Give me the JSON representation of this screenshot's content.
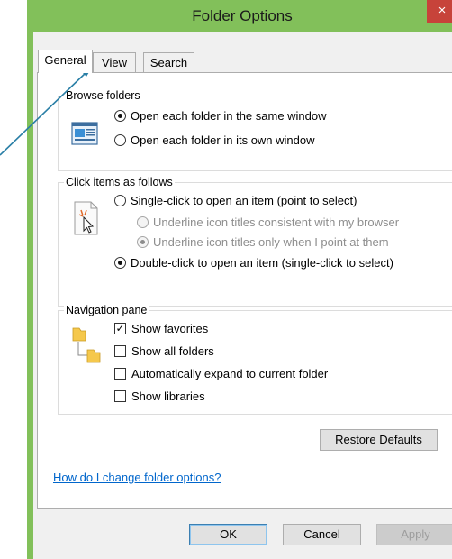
{
  "window": {
    "title": "Folder Options",
    "close_glyph": "×"
  },
  "tabs": [
    {
      "label": "General",
      "active": true
    },
    {
      "label": "View",
      "active": false
    },
    {
      "label": "Search",
      "active": false
    }
  ],
  "browse_folders": {
    "title": "Browse folders",
    "icon": "browse-window-icon",
    "options": [
      {
        "label": "Open each folder in the same window",
        "checked": true
      },
      {
        "label": "Open each folder in its own window",
        "checked": false
      }
    ]
  },
  "click_items": {
    "title": "Click items as follows",
    "icon": "pointer-click-icon",
    "options": [
      {
        "label": "Single-click to open an item (point to select)",
        "checked": false
      },
      {
        "label": "Underline icon titles consistent with my browser",
        "checked": false,
        "disabled": true
      },
      {
        "label": "Underline icon titles only when I point at them",
        "checked": true,
        "disabled": true
      },
      {
        "label": "Double-click to open an item (single-click to select)",
        "checked": true
      }
    ]
  },
  "navigation_pane": {
    "title": "Navigation pane",
    "icon": "folder-tree-icon",
    "options": [
      {
        "label": "Show favorites",
        "checked": true
      },
      {
        "label": "Show all folders",
        "checked": false
      },
      {
        "label": "Automatically expand to current folder",
        "checked": false
      },
      {
        "label": "Show libraries",
        "checked": false
      }
    ]
  },
  "restore_defaults_label": "Restore Defaults",
  "help_link": "How do I change folder options?",
  "footer": {
    "ok_label": "OK",
    "cancel_label": "Cancel",
    "apply_label": "Apply"
  },
  "colors": {
    "title_bar": "#82c05a",
    "close_button": "#c7433a",
    "link": "#0066cc",
    "annotation_arrow": "#2a7fa6"
  }
}
